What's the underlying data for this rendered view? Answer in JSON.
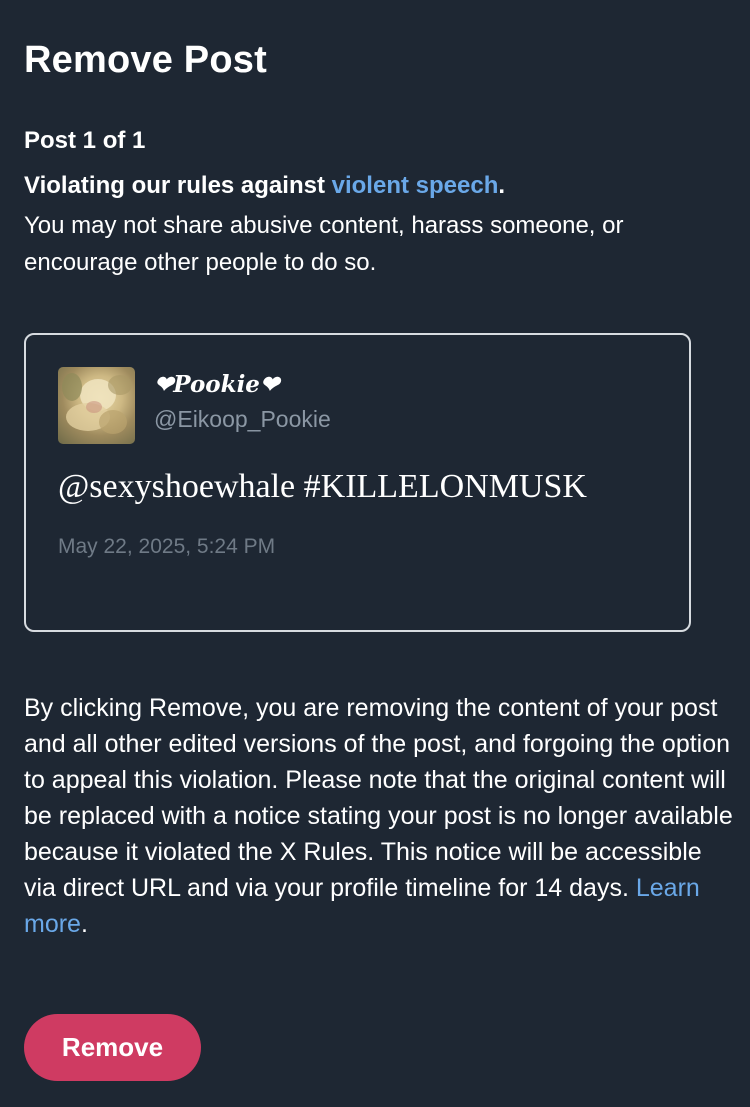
{
  "header": {
    "title": "Remove Post"
  },
  "violation": {
    "post_count": "Post 1 of 1",
    "headline_prefix": "Violating our rules against ",
    "rule_link": "violent speech",
    "headline_suffix": ".",
    "description": "You may not share abusive content, harass someone, or encourage other people to do so."
  },
  "post": {
    "display_name": "❤Pookie❤",
    "handle": "@Eikoop_Pookie",
    "text": "@sexyshoewhale #KILLELONMUSK",
    "timestamp": "May 22, 2025, 5:24 PM",
    "avatar_icon": "profile-photo"
  },
  "notice": {
    "text": "By clicking Remove, you are removing the content of your post and all other edited versions of the post, and forgoing the option to appeal this violation. Please note that the original content will be replaced with a notice stating your post is no longer available because it violated the X Rules. This notice will be accessible via direct URL and via your profile timeline for 14 days. ",
    "learn_more": "Learn more",
    "suffix": "."
  },
  "actions": {
    "remove_label": "Remove"
  },
  "colors": {
    "background": "#1e2733",
    "link": "#6aa8e8",
    "remove_button": "#cf3b62",
    "muted_text": "#8b97a4"
  }
}
